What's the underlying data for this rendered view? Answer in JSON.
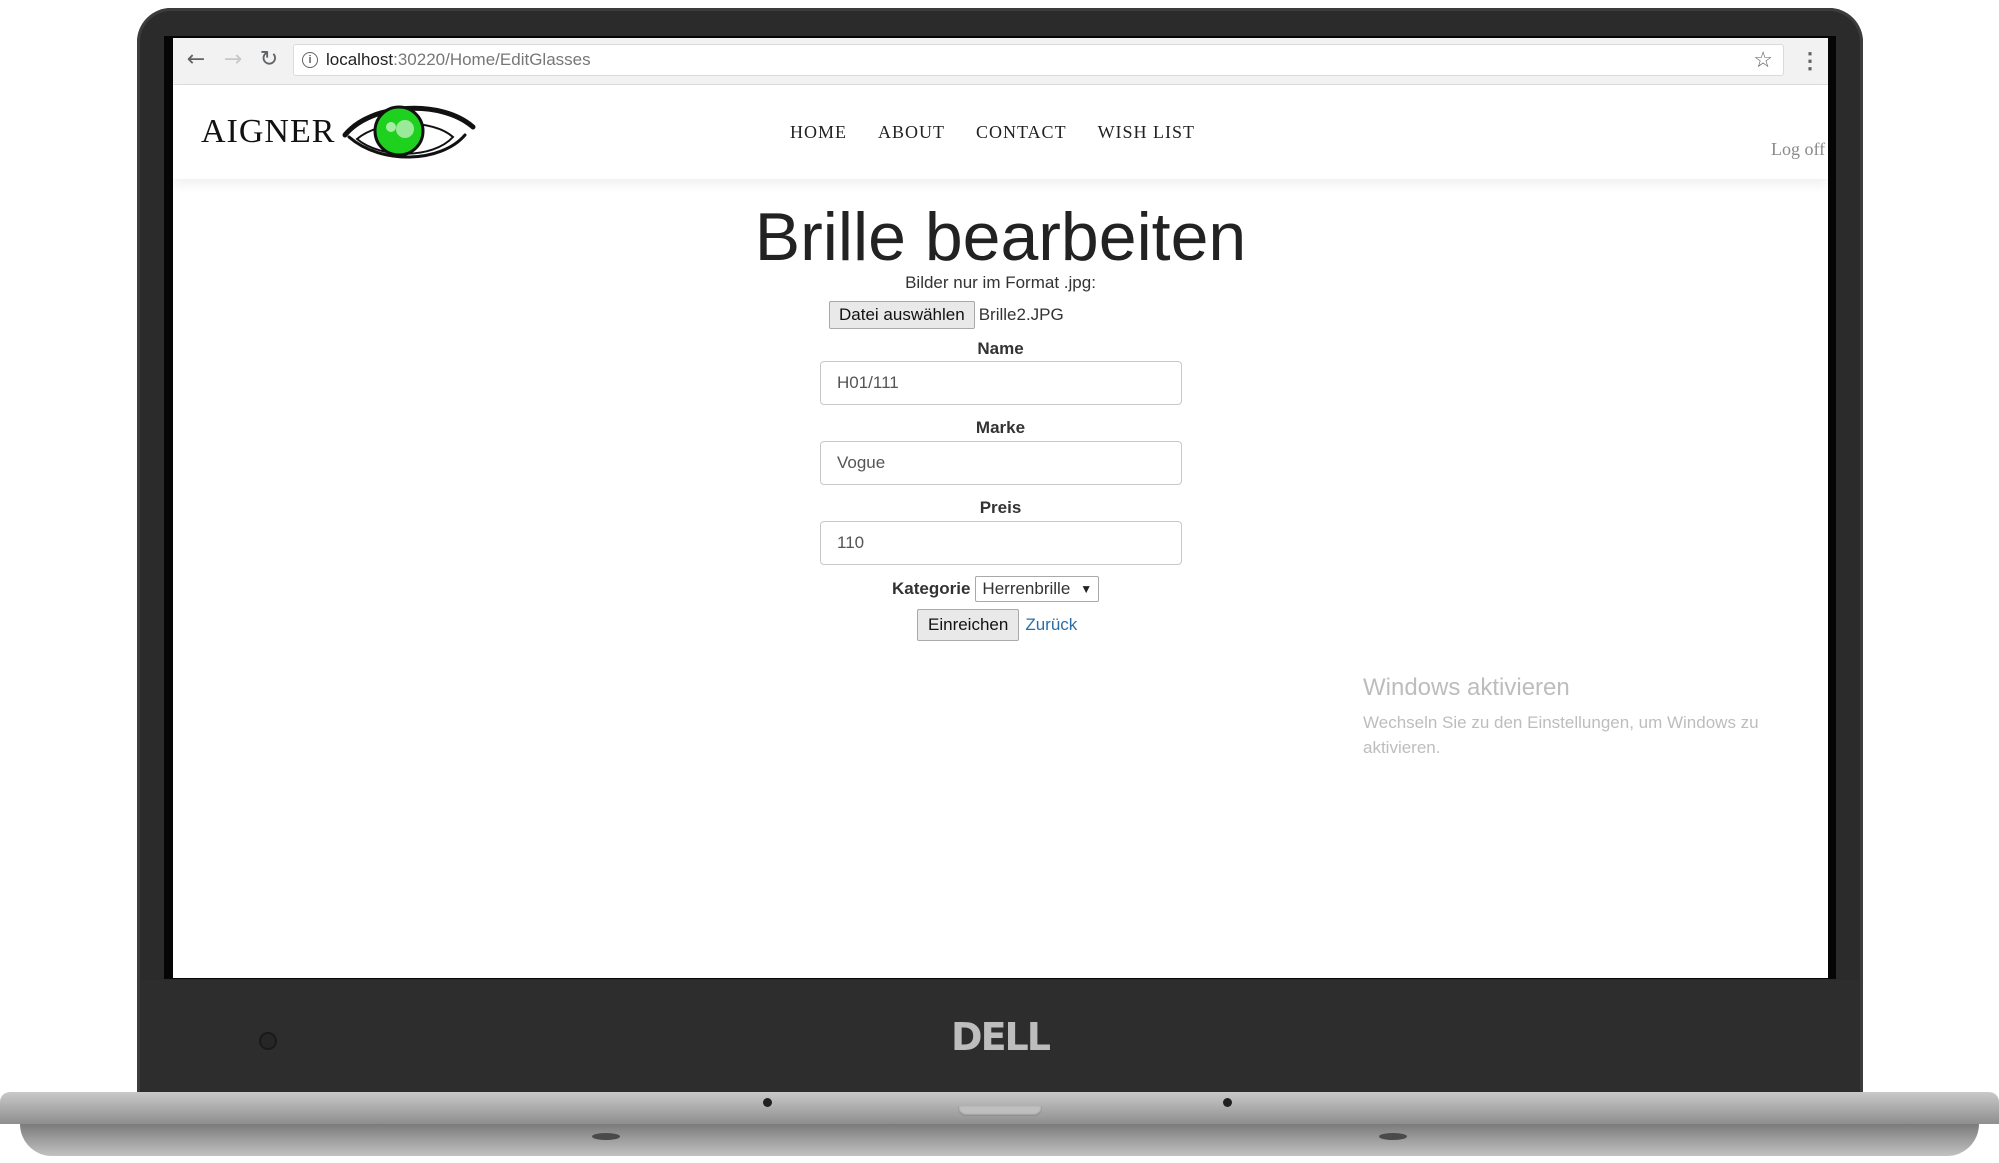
{
  "browser": {
    "url_host": "localhost",
    "url_rest": ":30220/Home/EditGlasses",
    "back_icon": "←",
    "forward_icon": "→",
    "reload_icon": "↻",
    "info_icon": "i",
    "star_icon": "☆",
    "menu_icon": "⋮"
  },
  "site": {
    "logo_text": "AIGNER",
    "eye_color": "#1fd11f",
    "nav": [
      "HOME",
      "ABOUT",
      "CONTACT",
      "WISH LIST"
    ],
    "logoff": "Log off"
  },
  "form": {
    "title": "Brille bearbeiten",
    "hint": "Bilder nur im Format .jpg:",
    "file_button": "Datei auswählen",
    "file_name": "Brille2.JPG",
    "name_label": "Name",
    "name_value": "H01/111",
    "marke_label": "Marke",
    "marke_value": "Vogue",
    "preis_label": "Preis",
    "preis_value": "110",
    "kategorie_label": "Kategorie",
    "kategorie_value": "Herrenbrille",
    "kategorie_arrow": "▼",
    "submit": "Einreichen",
    "back": "Zurück",
    "link_color": "#2a6fa8"
  },
  "watermark": {
    "title": "Windows aktivieren",
    "text": "Wechseln Sie zu den Einstellungen, um Windows zu aktivieren."
  },
  "device": {
    "brand": "DELL"
  }
}
